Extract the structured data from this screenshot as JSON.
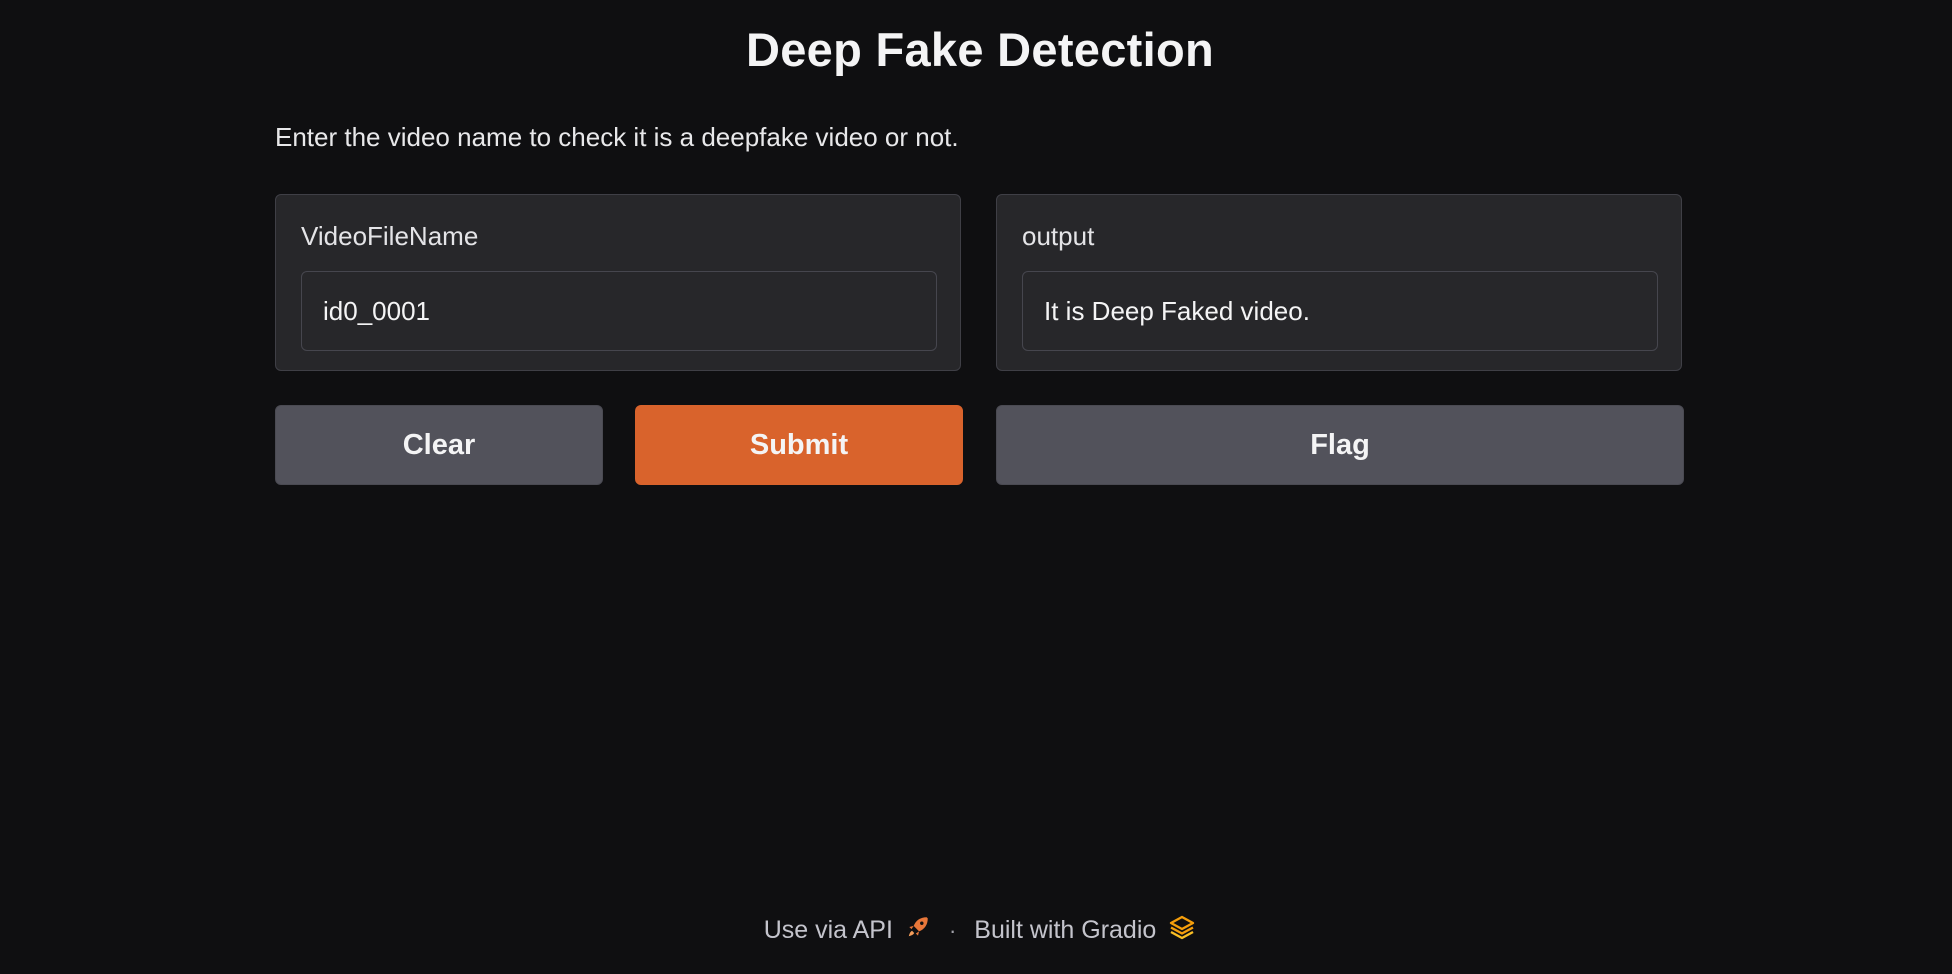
{
  "app": {
    "title": "Deep Fake Detection",
    "description": "Enter the video name to check it is a deepfake video or not."
  },
  "input_panel": {
    "label": "VideoFileName",
    "value": "id0_0001"
  },
  "output_panel": {
    "label": "output",
    "value": "It is Deep Faked video."
  },
  "buttons": {
    "clear_label": "Clear",
    "submit_label": "Submit",
    "flag_label": "Flag"
  },
  "footer": {
    "api_label": "Use via API",
    "api_icon": "rocket-icon",
    "separator": "·",
    "built_label": "Built with Gradio",
    "built_icon": "gradio-logo-icon"
  },
  "colors": {
    "background": "#0f0f11",
    "panel": "#27272a",
    "accent": "#d9632c",
    "secondary_button": "#52525b"
  }
}
